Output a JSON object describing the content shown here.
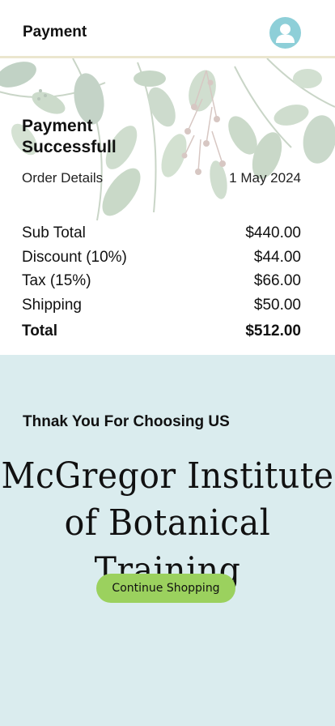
{
  "header": {
    "title": "Payment",
    "avatar_icon": "user-icon",
    "avatar_color": "#8ecfd8"
  },
  "receipt": {
    "status_title": "Payment Successfull",
    "order_label": "Order Details",
    "order_date": "1 May 2024",
    "lines": [
      {
        "label": "Sub Total",
        "value": "$440.00"
      },
      {
        "label": "Discount (10%)",
        "value": "$44.00"
      },
      {
        "label": "Tax (15%)",
        "value": "$66.00"
      },
      {
        "label": "Shipping",
        "value": "$50.00"
      }
    ],
    "total": {
      "label": "Total",
      "value": "$512.00"
    }
  },
  "thanks": {
    "message": "Thnak You For Choosing US",
    "brand_line1": "McGregor Institute",
    "brand_line2": "of Botanical Training"
  },
  "actions": {
    "continue_label": "Continue Shopping",
    "continue_color": "#9bd15e"
  },
  "theme": {
    "bottom_background": "#daecee",
    "divider_color": "#ebe6cf"
  }
}
